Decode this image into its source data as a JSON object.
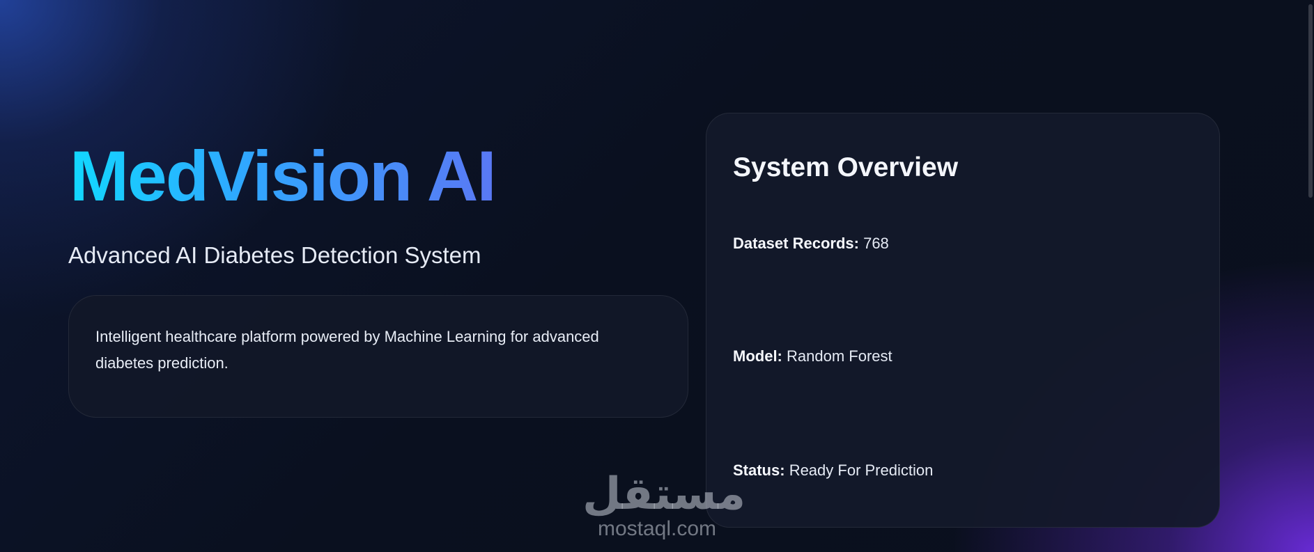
{
  "hero": {
    "title": "MedVision AI",
    "subtitle": "Advanced AI Diabetes Detection System",
    "description": "Intelligent healthcare platform powered by Machine Learning for advanced diabetes prediction."
  },
  "overview": {
    "title": "System Overview",
    "stats": [
      {
        "label": "Dataset Records:",
        "value": "768"
      },
      {
        "label": "Model:",
        "value": "Random Forest"
      },
      {
        "label": "Status:",
        "value": "Ready For Prediction"
      }
    ]
  },
  "watermark": {
    "arabic": "مستقل",
    "latin": "mostaql.com"
  },
  "colors": {
    "background": "#0b1120",
    "title_gradient_start": "#12d8ff",
    "title_gradient_end": "#5a78f4",
    "card": "#131a2a",
    "accent_purple": "#6c2cdc"
  }
}
